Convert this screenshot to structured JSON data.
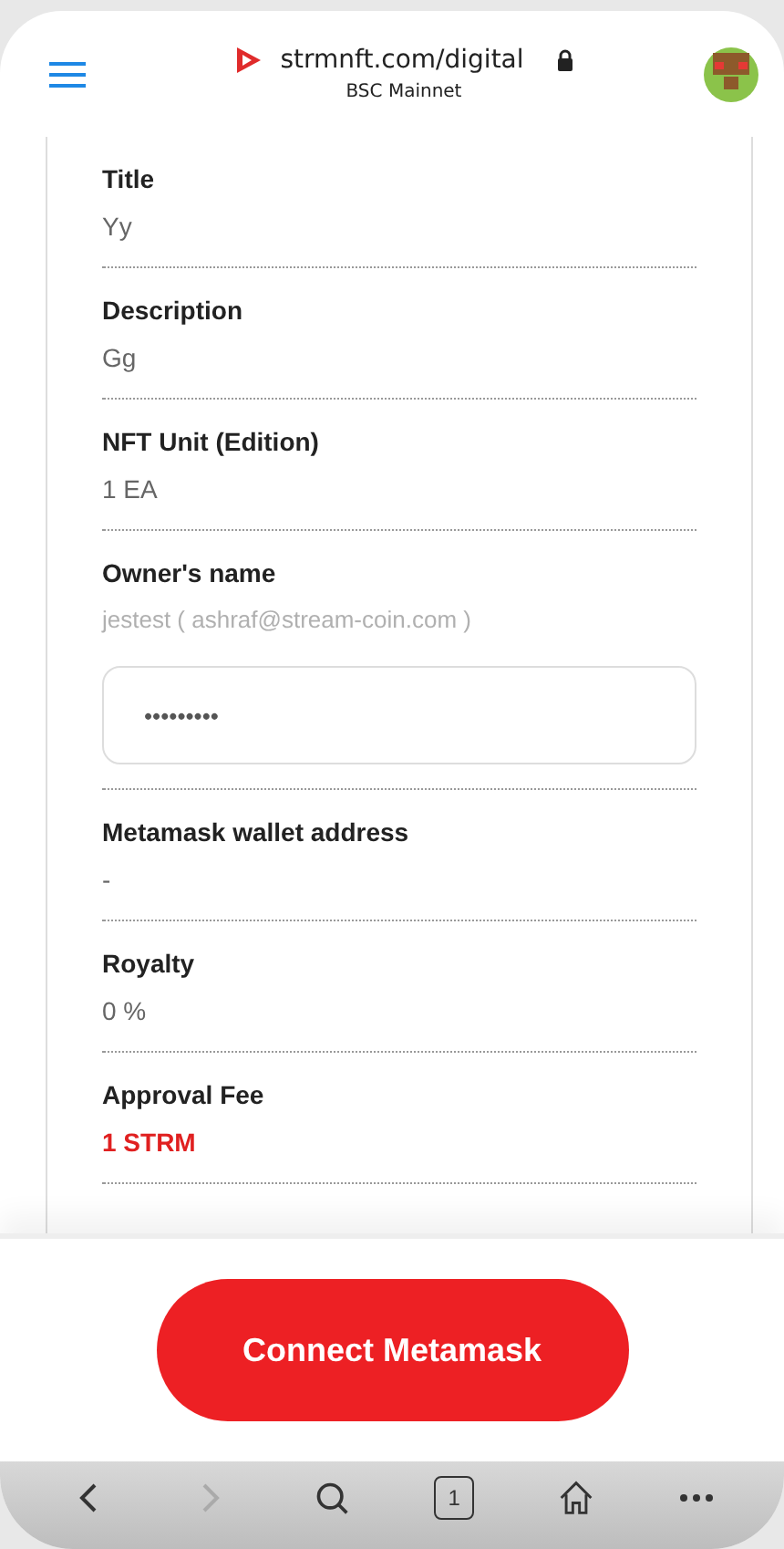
{
  "header": {
    "url": "strmnft.com/digital",
    "network": "BSC Mainnet",
    "secure": true
  },
  "fields": [
    {
      "label": "Title",
      "value": "Yy",
      "kind": "plain"
    },
    {
      "label": "Description",
      "value": "Gg",
      "kind": "plain"
    },
    {
      "label": "NFT Unit (Edition)",
      "value": "1 EA",
      "kind": "plain"
    },
    {
      "label": "Owner's name",
      "value": "jestest ( ashraf@stream-coin.com )",
      "kind": "muted",
      "input": {
        "value": "•••••••••"
      }
    },
    {
      "label": "Metamask wallet address",
      "value": "-",
      "kind": "plain"
    },
    {
      "label": "Royalty",
      "value": "0 %",
      "kind": "plain"
    },
    {
      "label": "Approval Fee",
      "value": "1 STRM",
      "kind": "price"
    }
  ],
  "action": {
    "label": "Connect Metamask"
  },
  "nav": [
    {
      "kind": "back",
      "disabled": false
    },
    {
      "kind": "forward",
      "disabled": true
    },
    {
      "kind": "search",
      "disabled": false
    },
    {
      "kind": "tabs",
      "count": "1",
      "disabled": false
    },
    {
      "kind": "home",
      "disabled": false
    },
    {
      "kind": "more",
      "disabled": false
    }
  ]
}
